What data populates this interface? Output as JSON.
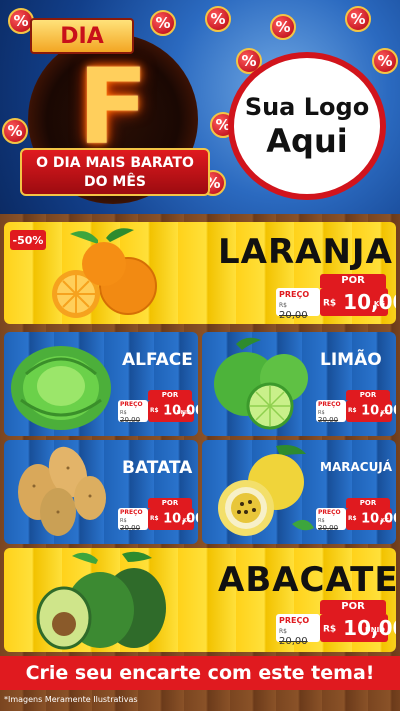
{
  "header": {
    "dia_label": "DIA",
    "big_letter": "F",
    "ribbon_line1": "O DIA MAIS BARATO",
    "ribbon_line2": "DO MÊS",
    "coin_symbol": "%",
    "logo_line1": "Sua Logo",
    "logo_line2": "Aqui"
  },
  "products": [
    {
      "name": "LARANJA",
      "discount": "-50%",
      "price_label": "PREÇO",
      "old_price": "20,00",
      "old_prefix": "R$",
      "por": "POR",
      "currency": "R$",
      "new_price": "10,00",
      "unit": "KG"
    },
    {
      "name": "ALFACE",
      "price_label": "PREÇO",
      "old_price": "20,00",
      "old_prefix": "R$",
      "por": "POR",
      "currency": "R$",
      "new_price": "10,00",
      "unit": "UNID"
    },
    {
      "name": "LIMÃO",
      "price_label": "PREÇO",
      "old_price": "20,00",
      "old_prefix": "R$",
      "por": "POR",
      "currency": "R$",
      "new_price": "10,00",
      "unit": "KG"
    },
    {
      "name": "BATATA",
      "price_label": "PREÇO",
      "old_price": "20,00",
      "old_prefix": "R$",
      "por": "POR",
      "currency": "R$",
      "new_price": "10,00",
      "unit": "KG"
    },
    {
      "name": "MARACUJÁ",
      "price_label": "PREÇO",
      "old_price": "20,00",
      "old_prefix": "R$",
      "por": "POR",
      "currency": "R$",
      "new_price": "10,00",
      "unit": "KG"
    },
    {
      "name": "ABACATE",
      "price_label": "PREÇO",
      "old_price": "20,00",
      "old_prefix": "R$",
      "por": "POR",
      "currency": "R$",
      "new_price": "10,00",
      "unit": "UNID"
    }
  ],
  "footer": {
    "cta": "Crie seu encarte com este tema!",
    "disclaimer": "*Imagens Meramente Ilustrativas"
  },
  "colors": {
    "red": "#e01a1f",
    "yellow": "#ffd21a",
    "blue": "#2a73cc"
  }
}
